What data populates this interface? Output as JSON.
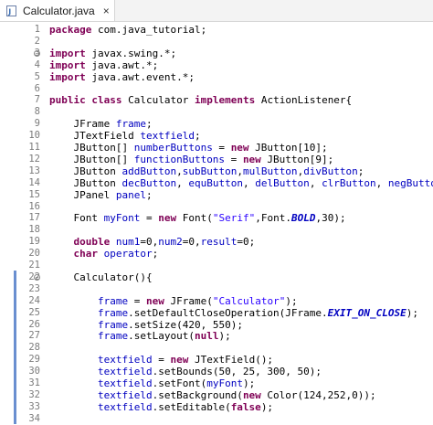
{
  "tab": {
    "label": "Calculator.java",
    "close": "×"
  },
  "lines": [
    {
      "n": "1",
      "fold": false,
      "code": [
        {
          "t": "package",
          "c": "kw"
        },
        {
          "t": " com.java_tutorial;",
          "c": ""
        }
      ]
    },
    {
      "n": "2",
      "fold": false,
      "code": []
    },
    {
      "n": "3",
      "fold": true,
      "code": [
        {
          "t": "import",
          "c": "kw"
        },
        {
          "t": " javax.swing.*;",
          "c": ""
        }
      ]
    },
    {
      "n": "4",
      "fold": false,
      "code": [
        {
          "t": "import",
          "c": "kw"
        },
        {
          "t": " java.awt.*;",
          "c": ""
        }
      ]
    },
    {
      "n": "5",
      "fold": false,
      "code": [
        {
          "t": "import",
          "c": "kw"
        },
        {
          "t": " java.awt.event.*;",
          "c": ""
        }
      ]
    },
    {
      "n": "6",
      "fold": false,
      "code": []
    },
    {
      "n": "7",
      "fold": false,
      "code": [
        {
          "t": "public",
          "c": "kw"
        },
        {
          "t": " ",
          "c": ""
        },
        {
          "t": "class",
          "c": "kw"
        },
        {
          "t": " Calculator ",
          "c": ""
        },
        {
          "t": "implements",
          "c": "kw"
        },
        {
          "t": " ActionListener{",
          "c": ""
        }
      ]
    },
    {
      "n": "8",
      "fold": false,
      "code": []
    },
    {
      "n": "9",
      "fold": false,
      "code": [
        {
          "t": "    JFrame ",
          "c": ""
        },
        {
          "t": "frame",
          "c": "fld"
        },
        {
          "t": ";",
          "c": ""
        }
      ]
    },
    {
      "n": "10",
      "fold": false,
      "code": [
        {
          "t": "    JTextField ",
          "c": ""
        },
        {
          "t": "textfield",
          "c": "fld"
        },
        {
          "t": ";",
          "c": ""
        }
      ]
    },
    {
      "n": "11",
      "fold": false,
      "code": [
        {
          "t": "    JButton[] ",
          "c": ""
        },
        {
          "t": "numberButtons",
          "c": "fld"
        },
        {
          "t": " = ",
          "c": ""
        },
        {
          "t": "new",
          "c": "kw"
        },
        {
          "t": " JButton[10];",
          "c": ""
        }
      ]
    },
    {
      "n": "12",
      "fold": false,
      "code": [
        {
          "t": "    JButton[] ",
          "c": ""
        },
        {
          "t": "functionButtons",
          "c": "fld"
        },
        {
          "t": " = ",
          "c": ""
        },
        {
          "t": "new",
          "c": "kw"
        },
        {
          "t": " JButton[9];",
          "c": ""
        }
      ]
    },
    {
      "n": "13",
      "fold": false,
      "code": [
        {
          "t": "    JButton ",
          "c": ""
        },
        {
          "t": "addButton",
          "c": "fld"
        },
        {
          "t": ",",
          "c": ""
        },
        {
          "t": "subButton",
          "c": "fld"
        },
        {
          "t": ",",
          "c": ""
        },
        {
          "t": "mulButton",
          "c": "fld"
        },
        {
          "t": ",",
          "c": ""
        },
        {
          "t": "divButton",
          "c": "fld"
        },
        {
          "t": ";",
          "c": ""
        }
      ]
    },
    {
      "n": "14",
      "fold": false,
      "code": [
        {
          "t": "    JButton ",
          "c": ""
        },
        {
          "t": "decButton",
          "c": "fld"
        },
        {
          "t": ", ",
          "c": ""
        },
        {
          "t": "equButton",
          "c": "fld"
        },
        {
          "t": ", ",
          "c": ""
        },
        {
          "t": "delButton",
          "c": "fld"
        },
        {
          "t": ", ",
          "c": ""
        },
        {
          "t": "clrButton",
          "c": "fld"
        },
        {
          "t": ", ",
          "c": ""
        },
        {
          "t": "negButton",
          "c": "fld"
        },
        {
          "t": ";",
          "c": ""
        }
      ]
    },
    {
      "n": "15",
      "fold": false,
      "code": [
        {
          "t": "    JPanel ",
          "c": ""
        },
        {
          "t": "panel",
          "c": "fld"
        },
        {
          "t": ";",
          "c": ""
        }
      ]
    },
    {
      "n": "16",
      "fold": false,
      "code": []
    },
    {
      "n": "17",
      "fold": false,
      "code": [
        {
          "t": "    Font ",
          "c": ""
        },
        {
          "t": "myFont",
          "c": "fld"
        },
        {
          "t": " = ",
          "c": ""
        },
        {
          "t": "new",
          "c": "kw"
        },
        {
          "t": " Font(",
          "c": ""
        },
        {
          "t": "\"Serif\"",
          "c": "str"
        },
        {
          "t": ",Font.",
          "c": ""
        },
        {
          "t": "BOLD",
          "c": "sfi"
        },
        {
          "t": ",30);",
          "c": ""
        }
      ]
    },
    {
      "n": "18",
      "fold": false,
      "code": []
    },
    {
      "n": "19",
      "fold": false,
      "code": [
        {
          "t": "    ",
          "c": ""
        },
        {
          "t": "double",
          "c": "kw"
        },
        {
          "t": " ",
          "c": ""
        },
        {
          "t": "num1",
          "c": "fld"
        },
        {
          "t": "=0,",
          "c": ""
        },
        {
          "t": "num2",
          "c": "fld"
        },
        {
          "t": "=0,",
          "c": ""
        },
        {
          "t": "result",
          "c": "fld"
        },
        {
          "t": "=0;",
          "c": ""
        }
      ]
    },
    {
      "n": "20",
      "fold": false,
      "code": [
        {
          "t": "    ",
          "c": ""
        },
        {
          "t": "char",
          "c": "kw"
        },
        {
          "t": " ",
          "c": ""
        },
        {
          "t": "operator",
          "c": "fld"
        },
        {
          "t": ";",
          "c": ""
        }
      ]
    },
    {
      "n": "21",
      "fold": false,
      "code": []
    },
    {
      "n": "22",
      "fold": true,
      "code": [
        {
          "t": "    Calculator(){",
          "c": ""
        }
      ]
    },
    {
      "n": "23",
      "fold": false,
      "code": []
    },
    {
      "n": "24",
      "fold": false,
      "code": [
        {
          "t": "        ",
          "c": ""
        },
        {
          "t": "frame",
          "c": "fld"
        },
        {
          "t": " = ",
          "c": ""
        },
        {
          "t": "new",
          "c": "kw"
        },
        {
          "t": " JFrame(",
          "c": ""
        },
        {
          "t": "\"Calculator\"",
          "c": "str"
        },
        {
          "t": ");",
          "c": ""
        }
      ]
    },
    {
      "n": "25",
      "fold": false,
      "code": [
        {
          "t": "        ",
          "c": ""
        },
        {
          "t": "frame",
          "c": "fld"
        },
        {
          "t": ".setDefaultCloseOperation(JFrame.",
          "c": ""
        },
        {
          "t": "EXIT_ON_CLOSE",
          "c": "sfi"
        },
        {
          "t": ");",
          "c": ""
        }
      ]
    },
    {
      "n": "26",
      "fold": false,
      "code": [
        {
          "t": "        ",
          "c": ""
        },
        {
          "t": "frame",
          "c": "fld"
        },
        {
          "t": ".setSize(420, 550);",
          "c": ""
        }
      ]
    },
    {
      "n": "27",
      "fold": false,
      "code": [
        {
          "t": "        ",
          "c": ""
        },
        {
          "t": "frame",
          "c": "fld"
        },
        {
          "t": ".setLayout(",
          "c": ""
        },
        {
          "t": "null",
          "c": "kw"
        },
        {
          "t": ");",
          "c": ""
        }
      ]
    },
    {
      "n": "28",
      "fold": false,
      "code": []
    },
    {
      "n": "29",
      "fold": false,
      "code": [
        {
          "t": "        ",
          "c": ""
        },
        {
          "t": "textfield",
          "c": "fld"
        },
        {
          "t": " = ",
          "c": ""
        },
        {
          "t": "new",
          "c": "kw"
        },
        {
          "t": " JTextField();",
          "c": ""
        }
      ]
    },
    {
      "n": "30",
      "fold": false,
      "code": [
        {
          "t": "        ",
          "c": ""
        },
        {
          "t": "textfield",
          "c": "fld"
        },
        {
          "t": ".setBounds(50, 25, 300, 50);",
          "c": ""
        }
      ]
    },
    {
      "n": "31",
      "fold": false,
      "code": [
        {
          "t": "        ",
          "c": ""
        },
        {
          "t": "textfield",
          "c": "fld"
        },
        {
          "t": ".setFont(",
          "c": ""
        },
        {
          "t": "myFont",
          "c": "fld"
        },
        {
          "t": ");",
          "c": ""
        }
      ]
    },
    {
      "n": "32",
      "fold": false,
      "code": [
        {
          "t": "        ",
          "c": ""
        },
        {
          "t": "textfield",
          "c": "fld"
        },
        {
          "t": ".setBackground(",
          "c": ""
        },
        {
          "t": "new",
          "c": "kw"
        },
        {
          "t": " Color(124,252,0));",
          "c": ""
        }
      ]
    },
    {
      "n": "33",
      "fold": false,
      "code": [
        {
          "t": "        ",
          "c": ""
        },
        {
          "t": "textfield",
          "c": "fld"
        },
        {
          "t": ".setEditable(",
          "c": ""
        },
        {
          "t": "false",
          "c": "kw"
        },
        {
          "t": ");",
          "c": ""
        }
      ]
    },
    {
      "n": "34",
      "fold": false,
      "code": []
    }
  ]
}
